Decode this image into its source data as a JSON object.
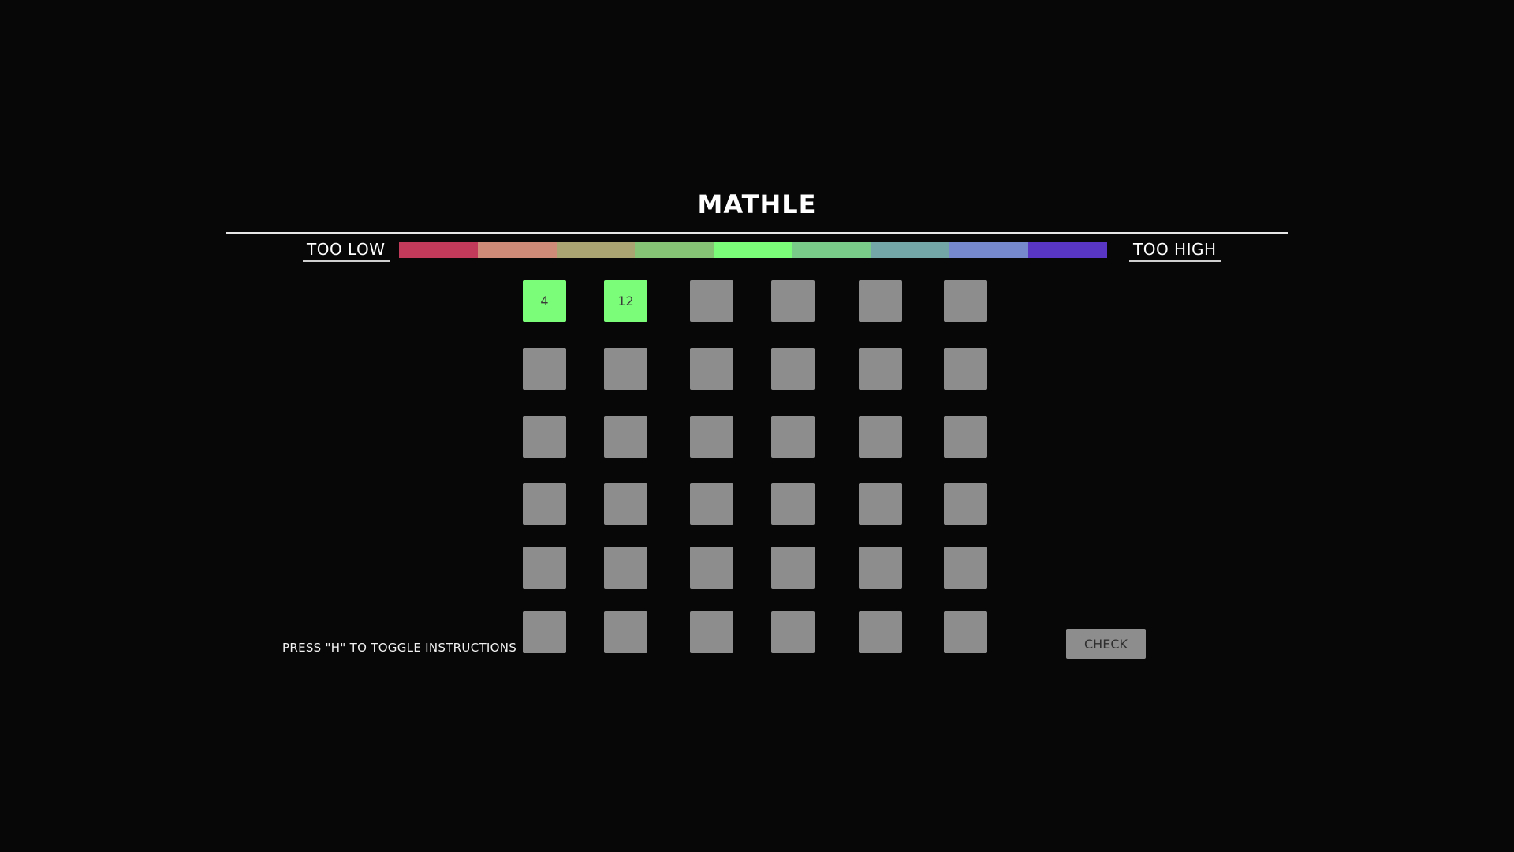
{
  "game": {
    "title": "MATHLE",
    "too_low_label": "TOO LOW",
    "too_high_label": "TOO HIGH",
    "instructions_hint": "PRESS \"H\" TO TOGGLE INSTRUCTIONS",
    "check_label": "CHECK"
  },
  "color_scale": [
    "#c23a5a",
    "#cd8b78",
    "#a9a472",
    "#86c374",
    "#7cfd79",
    "#79cb89",
    "#73a6a7",
    "#7789cd",
    "#5a36c5"
  ],
  "colors": {
    "background": "#070707",
    "empty_cell": "#8d8d8d",
    "correct_cell": "#7cfd79"
  },
  "board": {
    "rows": [
      [
        {
          "value": "4",
          "state": "correct"
        },
        {
          "value": "12",
          "state": "correct"
        },
        {
          "value": "",
          "state": "empty"
        },
        {
          "value": "",
          "state": "empty"
        },
        {
          "value": "",
          "state": "empty"
        },
        {
          "value": "",
          "state": "empty"
        }
      ],
      [
        {
          "value": "",
          "state": "empty"
        },
        {
          "value": "",
          "state": "empty"
        },
        {
          "value": "",
          "state": "empty"
        },
        {
          "value": "",
          "state": "empty"
        },
        {
          "value": "",
          "state": "empty"
        },
        {
          "value": "",
          "state": "empty"
        }
      ],
      [
        {
          "value": "",
          "state": "empty"
        },
        {
          "value": "",
          "state": "empty"
        },
        {
          "value": "",
          "state": "empty"
        },
        {
          "value": "",
          "state": "empty"
        },
        {
          "value": "",
          "state": "empty"
        },
        {
          "value": "",
          "state": "empty"
        }
      ],
      [
        {
          "value": "",
          "state": "empty"
        },
        {
          "value": "",
          "state": "empty"
        },
        {
          "value": "",
          "state": "empty"
        },
        {
          "value": "",
          "state": "empty"
        },
        {
          "value": "",
          "state": "empty"
        },
        {
          "value": "",
          "state": "empty"
        }
      ],
      [
        {
          "value": "",
          "state": "empty"
        },
        {
          "value": "",
          "state": "empty"
        },
        {
          "value": "",
          "state": "empty"
        },
        {
          "value": "",
          "state": "empty"
        },
        {
          "value": "",
          "state": "empty"
        },
        {
          "value": "",
          "state": "empty"
        }
      ],
      [
        {
          "value": "",
          "state": "empty"
        },
        {
          "value": "",
          "state": "empty"
        },
        {
          "value": "",
          "state": "empty"
        },
        {
          "value": "",
          "state": "empty"
        },
        {
          "value": "",
          "state": "empty"
        },
        {
          "value": "",
          "state": "empty"
        }
      ]
    ]
  }
}
